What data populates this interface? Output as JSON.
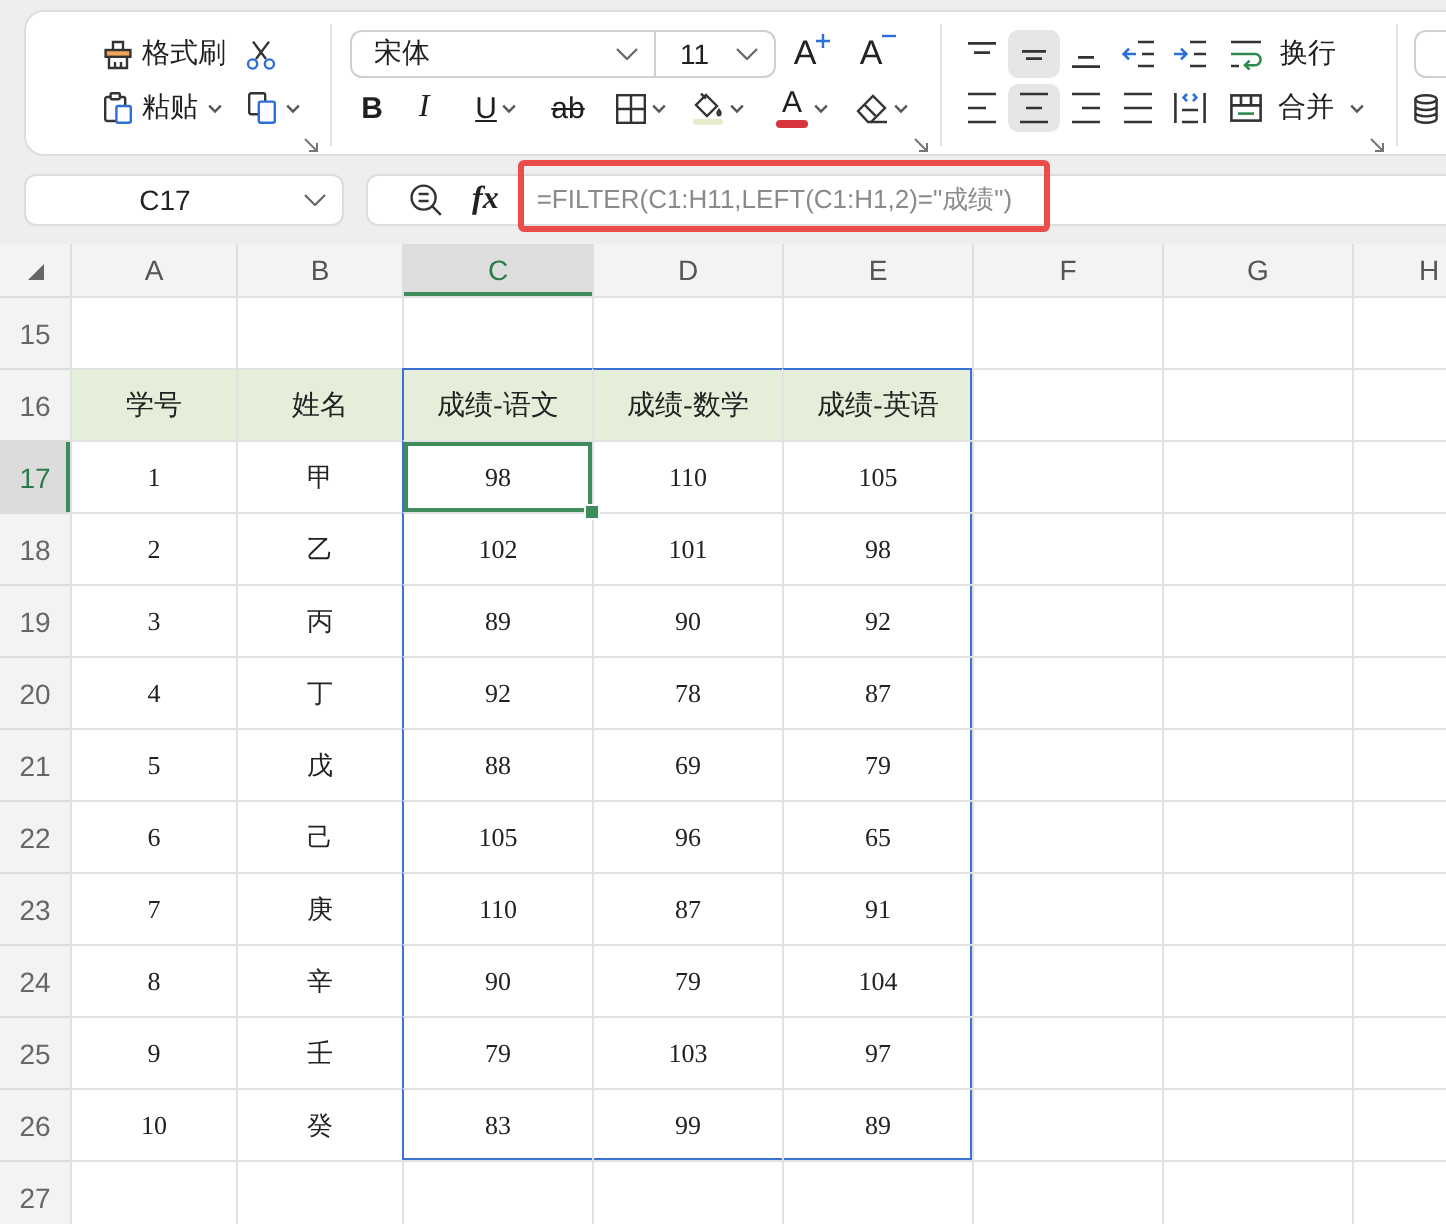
{
  "ribbon": {
    "clipboard": {
      "format_painter": "格式刷",
      "paste": "粘贴"
    },
    "font": {
      "family": "宋体",
      "size": "11",
      "grow": "A",
      "shrink": "A",
      "bold": "B",
      "italic": "I",
      "underline": "U",
      "strikethrough": "ab",
      "font_color": "A"
    },
    "alignment": {
      "vertical_align": [
        {
          "kind": "top",
          "selected": false
        },
        {
          "kind": "middle",
          "selected": true
        },
        {
          "kind": "bottom",
          "selected": false
        }
      ],
      "horizontal_align": [
        {
          "kind": "left",
          "selected": false
        },
        {
          "kind": "center",
          "selected": true
        },
        {
          "kind": "right",
          "selected": false
        },
        {
          "kind": "justify",
          "selected": false
        },
        {
          "kind": "distributed",
          "selected": false
        }
      ],
      "wrap": "换行",
      "merge": "合并"
    }
  },
  "formula_bar": {
    "name_box": "C17",
    "function_label": "fx",
    "formula": "=FILTER(C1:H11,LEFT(C1:H1,2)=\"成绩\")",
    "highlighted": true
  },
  "sheet": {
    "columns": [
      {
        "label": "A",
        "selected": false,
        "in_range": false
      },
      {
        "label": "B",
        "selected": false,
        "in_range": false
      },
      {
        "label": "C",
        "selected": true,
        "in_range": true
      },
      {
        "label": "D",
        "selected": false,
        "in_range": true
      },
      {
        "label": "E",
        "selected": false,
        "in_range": true
      },
      {
        "label": "F",
        "selected": false,
        "in_range": false
      },
      {
        "label": "G",
        "selected": false,
        "in_range": false
      },
      {
        "label": "H",
        "selected": false,
        "in_range": false
      }
    ],
    "rows": [
      {
        "number": "15",
        "kind": "blank",
        "selected": false,
        "in_range": false
      },
      {
        "number": "16",
        "kind": "header",
        "selected": false,
        "in_range": true,
        "cells": [
          "学号",
          "姓名",
          "成绩-语文",
          "成绩-数学",
          "成绩-英语"
        ]
      },
      {
        "number": "17",
        "kind": "data",
        "selected": true,
        "in_range": true,
        "cells": [
          "1",
          "甲",
          "98",
          "110",
          "105"
        ]
      },
      {
        "number": "18",
        "kind": "data",
        "selected": false,
        "in_range": true,
        "cells": [
          "2",
          "乙",
          "102",
          "101",
          "98"
        ]
      },
      {
        "number": "19",
        "kind": "data",
        "selected": false,
        "in_range": true,
        "cells": [
          "3",
          "丙",
          "89",
          "90",
          "92"
        ]
      },
      {
        "number": "20",
        "kind": "data",
        "selected": false,
        "in_range": true,
        "cells": [
          "4",
          "丁",
          "92",
          "78",
          "87"
        ]
      },
      {
        "number": "21",
        "kind": "data",
        "selected": false,
        "in_range": true,
        "cells": [
          "5",
          "戊",
          "88",
          "69",
          "79"
        ]
      },
      {
        "number": "22",
        "kind": "data",
        "selected": false,
        "in_range": true,
        "cells": [
          "6",
          "己",
          "105",
          "96",
          "65"
        ]
      },
      {
        "number": "23",
        "kind": "data",
        "selected": false,
        "in_range": true,
        "cells": [
          "7",
          "庚",
          "110",
          "87",
          "91"
        ]
      },
      {
        "number": "24",
        "kind": "data",
        "selected": false,
        "in_range": true,
        "cells": [
          "8",
          "辛",
          "90",
          "79",
          "104"
        ]
      },
      {
        "number": "25",
        "kind": "data",
        "selected": false,
        "in_range": true,
        "cells": [
          "9",
          "壬",
          "79",
          "103",
          "97"
        ]
      },
      {
        "number": "26",
        "kind": "data",
        "selected": false,
        "in_range": true,
        "cells": [
          "10",
          "癸",
          "83",
          "99",
          "89"
        ]
      },
      {
        "number": "27",
        "kind": "blank",
        "selected": false,
        "in_range": false
      }
    ]
  }
}
